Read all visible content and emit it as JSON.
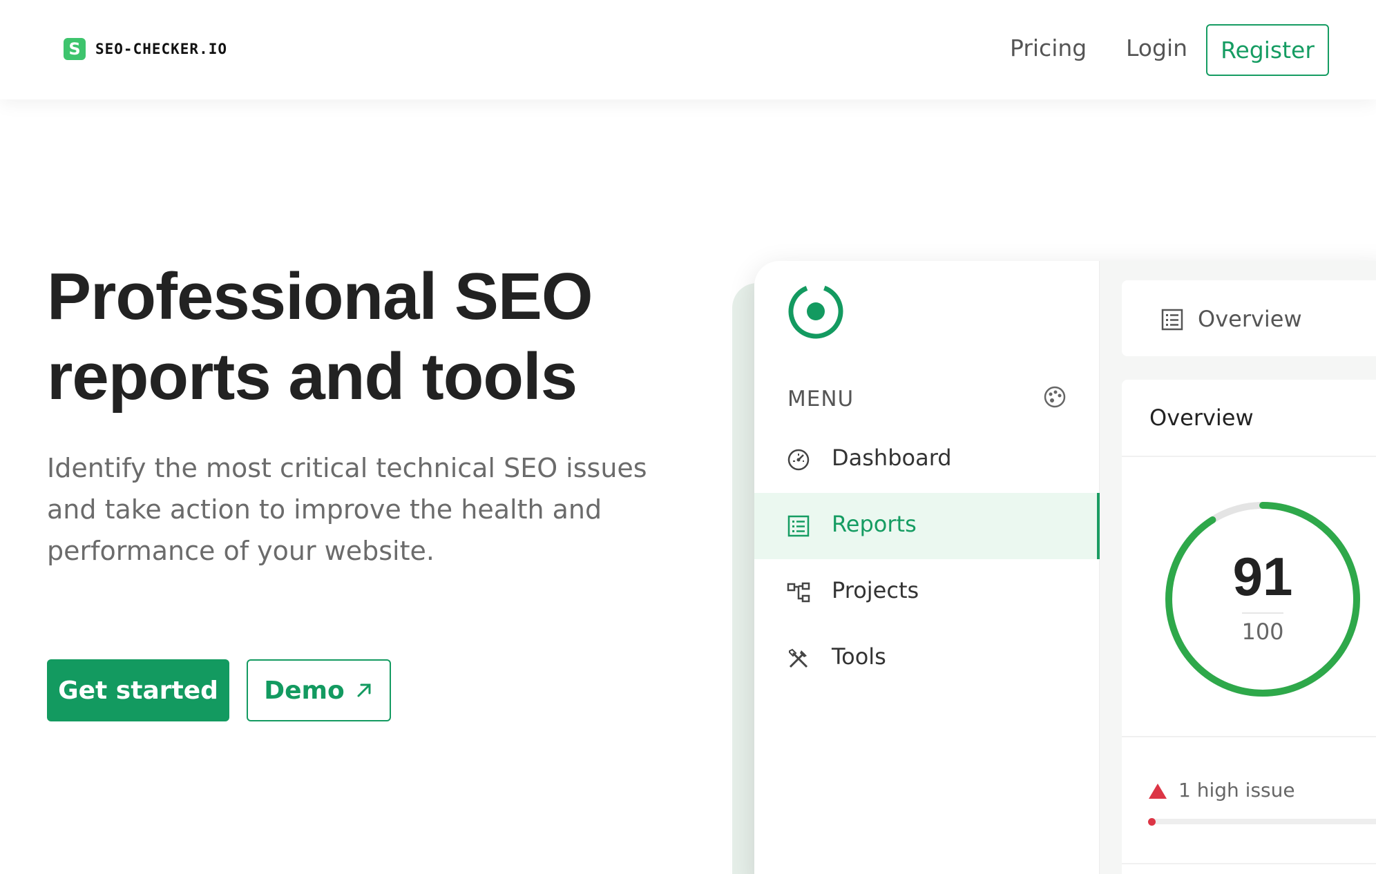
{
  "header": {
    "logo_letter": "S",
    "logo_text": "SEO-CHECKER.IO",
    "nav": {
      "pricing": "Pricing",
      "login": "Login",
      "register": "Register"
    }
  },
  "hero": {
    "title_line1": "Professional SEO",
    "title_line2": "reports and tools",
    "description": "Identify the most critical technical SEO issues and take action to improve the health and performance of your website.",
    "cta_primary": "Get started",
    "cta_secondary": "Demo",
    "cta_secondary_icon": "arrow-up-right-icon"
  },
  "app_preview": {
    "menu_label": "MENU",
    "menu_items": [
      {
        "label": "Dashboard",
        "icon": "dashboard-icon",
        "active": false
      },
      {
        "label": "Reports",
        "icon": "reports-icon",
        "active": true
      },
      {
        "label": "Projects",
        "icon": "projects-icon",
        "active": false
      },
      {
        "label": "Tools",
        "icon": "tools-icon",
        "active": false
      }
    ],
    "tab_label": "Overview",
    "overview": {
      "title": "Overview",
      "score": "91",
      "score_max": "100",
      "score_fraction": 0.91,
      "issue_text": "1 high issue"
    }
  },
  "colors": {
    "brand_green": "#139a60",
    "logo_green": "#3ec46d",
    "ring_green": "#2ea84a",
    "issue_red": "#dc3545"
  }
}
